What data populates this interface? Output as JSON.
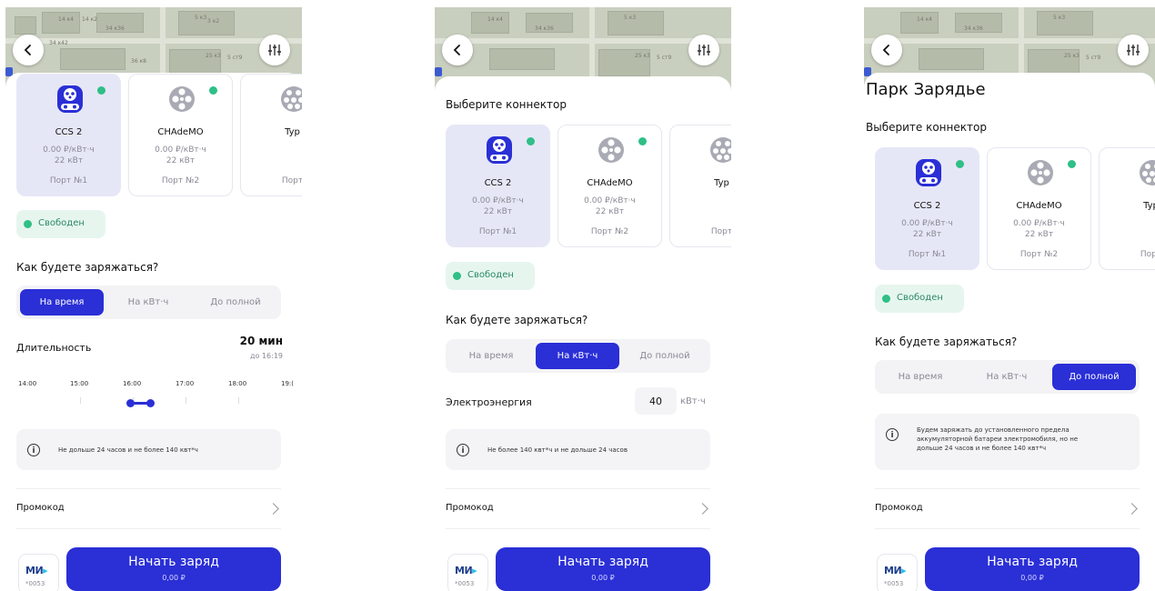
{
  "colors": {
    "accent": "#2a2fd6",
    "status_green": "#2fbf87",
    "selected_card": "#e6e7f6"
  },
  "map": {
    "labels": [
      "14 к4",
      "14 к2",
      "5 к3",
      "3 к2",
      "34 к36",
      "34 к42",
      "25 к3",
      "5 ст9",
      "36 к8"
    ]
  },
  "icons": {
    "back": "chevron-left-icon",
    "filter": "sliders-icon",
    "info": "info-icon",
    "connector": "connector-icon",
    "promo_chevron": "chevron-right-icon"
  },
  "screen1": {
    "cards": [
      {
        "name": "CCS 2",
        "price": "0.00 ₽/кВт·ч",
        "power": "22 кВт",
        "port": "Порт №1"
      },
      {
        "name": "CHAdeMO",
        "price": "0.00 ₽/кВт·ч",
        "power": "22 кВт",
        "port": "Порт №2"
      },
      {
        "name": "Typ",
        "port": "Порт"
      }
    ],
    "status": "Свободен",
    "question": "Как будете заряжаться?",
    "modes": [
      "На время",
      "На кВт·ч",
      "До полной"
    ],
    "duration_label": "Длительность",
    "duration_value": "20 мин",
    "duration_until": "до 16:19",
    "times": [
      "14:00",
      "15:00",
      "16:00",
      "17:00",
      "18:00",
      "19:("
    ],
    "note": "Не дольше 24 часов и не более 140 квт*ч",
    "promo": "Промокод",
    "card_mir": "МИР",
    "card_num": "*0053",
    "start": "Начать заряд",
    "amount": "0,00 ₽"
  },
  "screen2": {
    "connector_title": "Выберите коннектор",
    "cards": [
      {
        "name": "CCS 2",
        "price": "0.00 ₽/кВт·ч",
        "power": "22 кВт",
        "port": "Порт №1"
      },
      {
        "name": "CHAdeMO",
        "price": "0.00 ₽/кВт·ч",
        "power": "22 кВт",
        "port": "Порт №2"
      },
      {
        "name": "Typ",
        "port": "Порт"
      }
    ],
    "status": "Свободен",
    "question": "Как будете заряжаться?",
    "modes": [
      "На время",
      "На кВт·ч",
      "До полной"
    ],
    "energy_label": "Электроэнергия",
    "energy_value": "40",
    "energy_unit": "кВт·ч",
    "note": "Не более 140 квт*ч и не дольше 24 часов",
    "promo": "Промокод",
    "card_mir": "МИР",
    "card_num": "*0053",
    "start": "Начать заряд",
    "amount": "0,00 ₽"
  },
  "screen3": {
    "station": "Парк Зарядье",
    "connector_title": "Выберите коннектор",
    "cards": [
      {
        "name": "CCS 2",
        "price": "0.00 ₽/кВт·ч",
        "power": "22 кВт",
        "port": "Порт №1"
      },
      {
        "name": "CHAdeMO",
        "price": "0.00 ₽/кВт·ч",
        "power": "22 кВт",
        "port": "Порт №2"
      },
      {
        "name": "Typ",
        "port": "Порт"
      }
    ],
    "status": "Свободен",
    "question": "Как будете заряжаться?",
    "modes": [
      "На время",
      "На кВт·ч",
      "До полной"
    ],
    "note_lines": [
      "Будем заряжать до установленного предела",
      "аккумуляторной батареи электромобиля, но не",
      "дольше 24 часов и не более 140 квт*ч"
    ],
    "promo": "Промокод",
    "card_mir": "МИР",
    "card_num": "*0053",
    "start": "Начать заряд",
    "amount": "0,00 ₽"
  }
}
